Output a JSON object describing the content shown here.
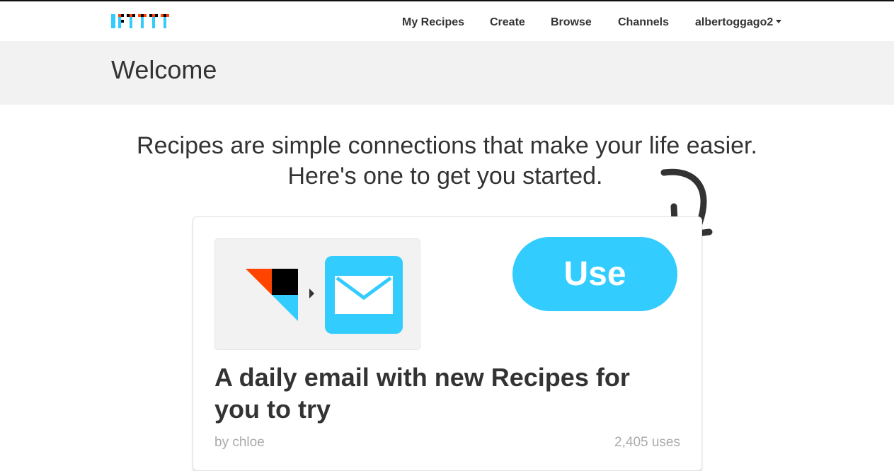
{
  "app": {
    "logo_text": "IFTTT",
    "brand_color": "#33ccff",
    "accent_color": "#ff4400"
  },
  "nav": {
    "links": [
      "My Recipes",
      "Create",
      "Browse",
      "Channels"
    ],
    "user": "albertoggago2"
  },
  "page": {
    "title": "Welcome"
  },
  "intro": {
    "line1": "Recipes are simple connections that make your life easier.",
    "line2": "Here's one to get you started."
  },
  "recipe": {
    "trigger_icon": "ifttt-recipe-icon",
    "action_icon": "email-icon",
    "use_label": "Use",
    "title": "A daily email with new Recipes for you to try",
    "author": "by chloe",
    "uses": "2,405 uses"
  }
}
